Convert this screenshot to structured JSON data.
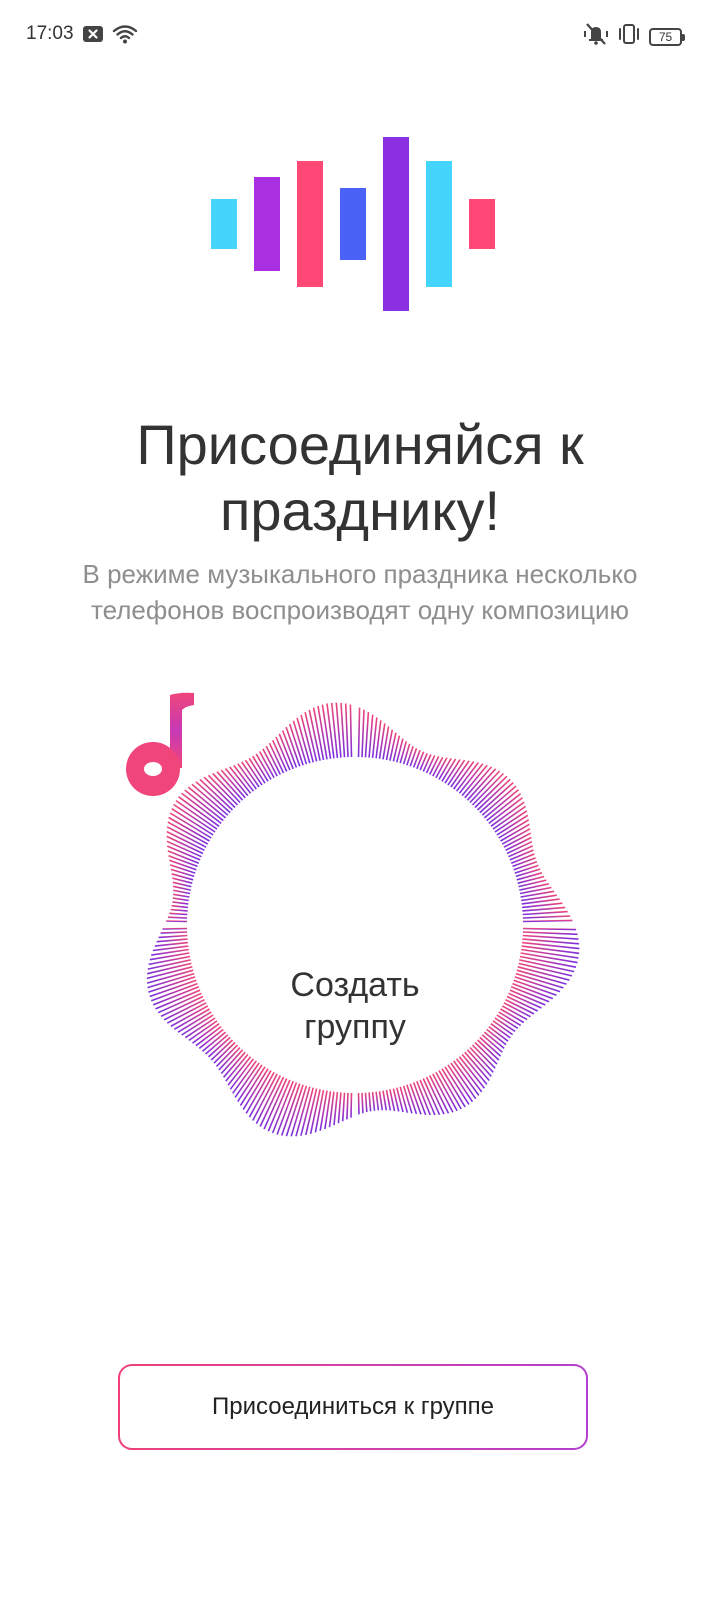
{
  "status_bar": {
    "time": "17:03",
    "battery": "75",
    "icons": [
      "notification-x-icon",
      "wifi-icon",
      "vibrate-mute-icon",
      "vibrate-icon",
      "battery-icon"
    ]
  },
  "logo": {
    "icon": "sound-wave-logo-icon",
    "colors": [
      "#45d4fb",
      "#a830e0",
      "#ff4876",
      "#4a62f6",
      "#8a30e0",
      "#45d4fb",
      "#ff4876"
    ]
  },
  "main": {
    "title": "Присоединяйся к празднику!",
    "description": "В режиме музыкального праздника несколько телефонов воспроизводят одну композицию"
  },
  "create_group": {
    "icon": "music-note-icon",
    "label_line1": "Создать",
    "label_line2": "группу",
    "accent_top": "#f0457a",
    "accent_bottom": "#7a30e0"
  },
  "join_group": {
    "label": "Присоединиться к группе"
  }
}
